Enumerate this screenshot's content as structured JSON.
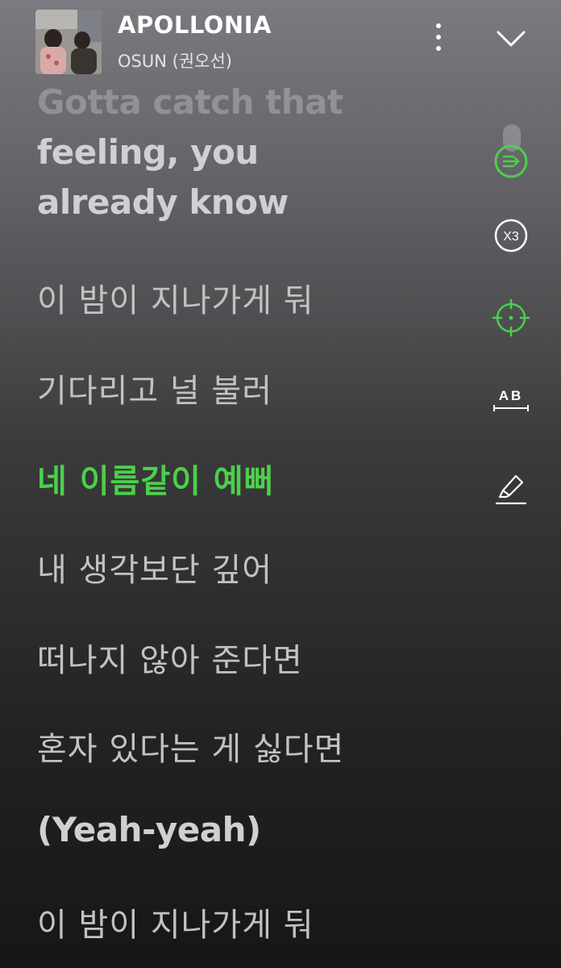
{
  "header": {
    "song_title": "APOLLONIA",
    "artist": "OSUN (권오선)",
    "more_icon": "more-vertical-icon",
    "collapse_icon": "chevron-down-icon"
  },
  "lyrics": [
    {
      "text": "Gotta catch that",
      "state": "faded"
    },
    {
      "text": "feeling, you",
      "state": "normal"
    },
    {
      "text": "already know",
      "state": "normal"
    },
    {
      "text": "이 밤이 지나가게 둬",
      "state": "normal"
    },
    {
      "text": "기다리고 널 불러",
      "state": "normal"
    },
    {
      "text": "네 이름같이 예뻐",
      "state": "active"
    },
    {
      "text": "내 생각보단 깊어",
      "state": "normal"
    },
    {
      "text": "떠나지 않아 준다면",
      "state": "normal"
    },
    {
      "text": "혼자 있다는 게 싫다면",
      "state": "normal"
    },
    {
      "text": "(Yeah-yeah)",
      "state": "normal"
    },
    {
      "text": "이 밤이 지나가게 둬",
      "state": "normal"
    }
  ],
  "tools": {
    "autoscroll_icon": "lyrics-autoscroll-icon",
    "speed_label": "X3",
    "focus_icon": "crosshair-icon",
    "translate_label": "AB",
    "highlight_icon": "highlighter-icon"
  },
  "colors": {
    "active": "#4cd04a",
    "text": "#c2c2c4"
  }
}
